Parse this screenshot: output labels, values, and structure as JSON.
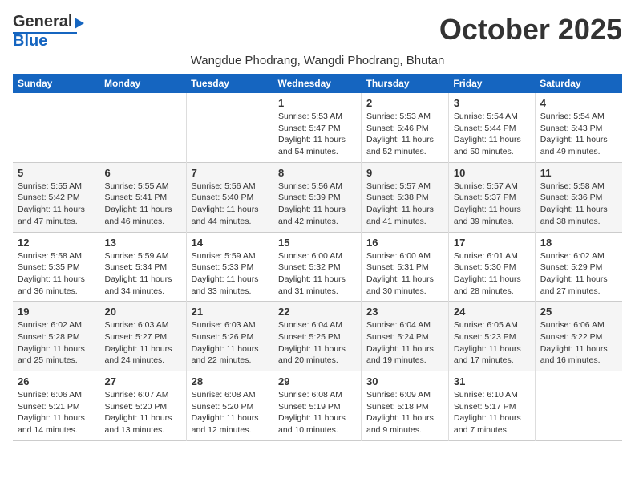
{
  "header": {
    "logo_line1": "General",
    "logo_line2": "Blue",
    "month": "October 2025",
    "location": "Wangdue Phodrang, Wangdi Phodrang, Bhutan"
  },
  "weekdays": [
    "Sunday",
    "Monday",
    "Tuesday",
    "Wednesday",
    "Thursday",
    "Friday",
    "Saturday"
  ],
  "weeks": [
    [
      {
        "day": "",
        "info": ""
      },
      {
        "day": "",
        "info": ""
      },
      {
        "day": "",
        "info": ""
      },
      {
        "day": "1",
        "info": "Sunrise: 5:53 AM\nSunset: 5:47 PM\nDaylight: 11 hours\nand 54 minutes."
      },
      {
        "day": "2",
        "info": "Sunrise: 5:53 AM\nSunset: 5:46 PM\nDaylight: 11 hours\nand 52 minutes."
      },
      {
        "day": "3",
        "info": "Sunrise: 5:54 AM\nSunset: 5:44 PM\nDaylight: 11 hours\nand 50 minutes."
      },
      {
        "day": "4",
        "info": "Sunrise: 5:54 AM\nSunset: 5:43 PM\nDaylight: 11 hours\nand 49 minutes."
      }
    ],
    [
      {
        "day": "5",
        "info": "Sunrise: 5:55 AM\nSunset: 5:42 PM\nDaylight: 11 hours\nand 47 minutes."
      },
      {
        "day": "6",
        "info": "Sunrise: 5:55 AM\nSunset: 5:41 PM\nDaylight: 11 hours\nand 46 minutes."
      },
      {
        "day": "7",
        "info": "Sunrise: 5:56 AM\nSunset: 5:40 PM\nDaylight: 11 hours\nand 44 minutes."
      },
      {
        "day": "8",
        "info": "Sunrise: 5:56 AM\nSunset: 5:39 PM\nDaylight: 11 hours\nand 42 minutes."
      },
      {
        "day": "9",
        "info": "Sunrise: 5:57 AM\nSunset: 5:38 PM\nDaylight: 11 hours\nand 41 minutes."
      },
      {
        "day": "10",
        "info": "Sunrise: 5:57 AM\nSunset: 5:37 PM\nDaylight: 11 hours\nand 39 minutes."
      },
      {
        "day": "11",
        "info": "Sunrise: 5:58 AM\nSunset: 5:36 PM\nDaylight: 11 hours\nand 38 minutes."
      }
    ],
    [
      {
        "day": "12",
        "info": "Sunrise: 5:58 AM\nSunset: 5:35 PM\nDaylight: 11 hours\nand 36 minutes."
      },
      {
        "day": "13",
        "info": "Sunrise: 5:59 AM\nSunset: 5:34 PM\nDaylight: 11 hours\nand 34 minutes."
      },
      {
        "day": "14",
        "info": "Sunrise: 5:59 AM\nSunset: 5:33 PM\nDaylight: 11 hours\nand 33 minutes."
      },
      {
        "day": "15",
        "info": "Sunrise: 6:00 AM\nSunset: 5:32 PM\nDaylight: 11 hours\nand 31 minutes."
      },
      {
        "day": "16",
        "info": "Sunrise: 6:00 AM\nSunset: 5:31 PM\nDaylight: 11 hours\nand 30 minutes."
      },
      {
        "day": "17",
        "info": "Sunrise: 6:01 AM\nSunset: 5:30 PM\nDaylight: 11 hours\nand 28 minutes."
      },
      {
        "day": "18",
        "info": "Sunrise: 6:02 AM\nSunset: 5:29 PM\nDaylight: 11 hours\nand 27 minutes."
      }
    ],
    [
      {
        "day": "19",
        "info": "Sunrise: 6:02 AM\nSunset: 5:28 PM\nDaylight: 11 hours\nand 25 minutes."
      },
      {
        "day": "20",
        "info": "Sunrise: 6:03 AM\nSunset: 5:27 PM\nDaylight: 11 hours\nand 24 minutes."
      },
      {
        "day": "21",
        "info": "Sunrise: 6:03 AM\nSunset: 5:26 PM\nDaylight: 11 hours\nand 22 minutes."
      },
      {
        "day": "22",
        "info": "Sunrise: 6:04 AM\nSunset: 5:25 PM\nDaylight: 11 hours\nand 20 minutes."
      },
      {
        "day": "23",
        "info": "Sunrise: 6:04 AM\nSunset: 5:24 PM\nDaylight: 11 hours\nand 19 minutes."
      },
      {
        "day": "24",
        "info": "Sunrise: 6:05 AM\nSunset: 5:23 PM\nDaylight: 11 hours\nand 17 minutes."
      },
      {
        "day": "25",
        "info": "Sunrise: 6:06 AM\nSunset: 5:22 PM\nDaylight: 11 hours\nand 16 minutes."
      }
    ],
    [
      {
        "day": "26",
        "info": "Sunrise: 6:06 AM\nSunset: 5:21 PM\nDaylight: 11 hours\nand 14 minutes."
      },
      {
        "day": "27",
        "info": "Sunrise: 6:07 AM\nSunset: 5:20 PM\nDaylight: 11 hours\nand 13 minutes."
      },
      {
        "day": "28",
        "info": "Sunrise: 6:08 AM\nSunset: 5:20 PM\nDaylight: 11 hours\nand 12 minutes."
      },
      {
        "day": "29",
        "info": "Sunrise: 6:08 AM\nSunset: 5:19 PM\nDaylight: 11 hours\nand 10 minutes."
      },
      {
        "day": "30",
        "info": "Sunrise: 6:09 AM\nSunset: 5:18 PM\nDaylight: 11 hours\nand 9 minutes."
      },
      {
        "day": "31",
        "info": "Sunrise: 6:10 AM\nSunset: 5:17 PM\nDaylight: 11 hours\nand 7 minutes."
      },
      {
        "day": "",
        "info": ""
      }
    ]
  ]
}
